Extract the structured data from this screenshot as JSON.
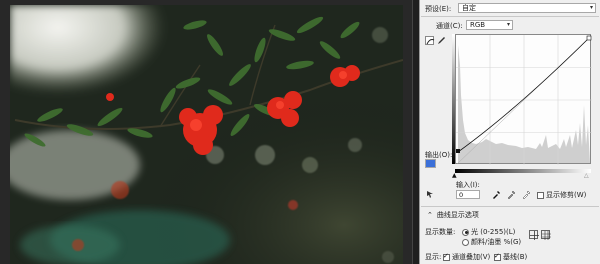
{
  "panel": {
    "preset_label": "预设(E):",
    "preset_value": "自定",
    "channel_label": "通道(C):",
    "channel_value": "RGB",
    "output_label": "输出(O):",
    "output_value": "",
    "input_label": "输入(I):",
    "input_value": "0",
    "show_clipping": "显示修剪(W)",
    "curve_options": "曲线显示选项",
    "show_amount_label": "显示数量:",
    "light_option": "光 (0-255)(L)",
    "pigment_option": "颜料/油墨 %(G)",
    "show_label": "显示:",
    "channel_overlay": "通道叠加(V)",
    "baseline": "基线(B)"
  },
  "icons": {
    "curve_tool": "curve-point-icon",
    "pencil_tool": "pencil-icon",
    "black_eyedropper": "eyedropper-black-icon",
    "gray_eyedropper": "eyedropper-gray-icon",
    "white_eyedropper": "eyedropper-white-icon",
    "hand_tool": "on-image-adjust-icon",
    "small_grid": "grid-4-icon",
    "large_grid": "grid-10-icon"
  },
  "colors": {
    "panel_bg": "#efefef",
    "accent_selected": "#3b6fd8"
  }
}
